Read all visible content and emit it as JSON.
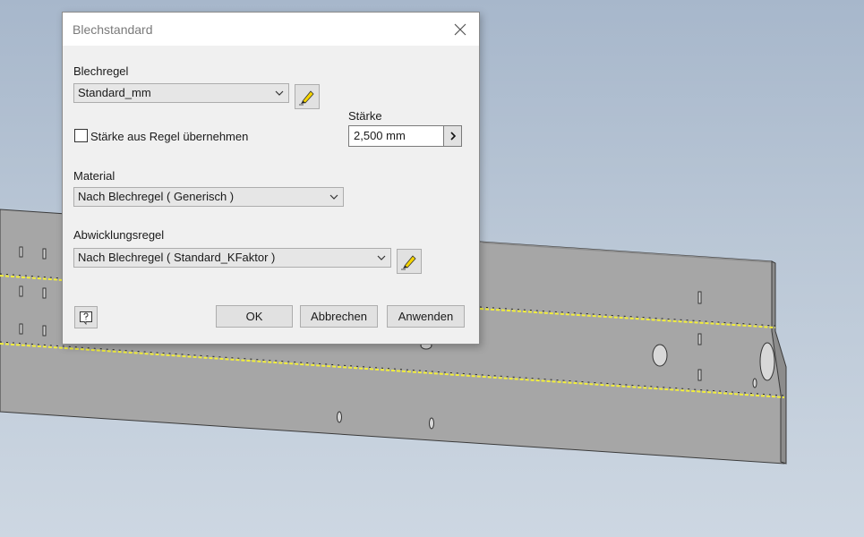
{
  "dialog": {
    "title": "Blechstandard",
    "sheet_rule_label": "Blechregel",
    "sheet_rule_value": "Standard_mm",
    "thickness_label": "Stärke",
    "thickness_value": "2,500 mm",
    "use_rule_thickness_label": "Stärke aus Regel übernehmen",
    "material_label": "Material",
    "material_value": "Nach Blechregel ( Generisch )",
    "unfold_rule_label": "Abwicklungsregel",
    "unfold_rule_value": "Nach Blechregel ( Standard_KFaktor )",
    "ok_label": "OK",
    "cancel_label": "Abbrechen",
    "apply_label": "Anwenden"
  },
  "icons": {
    "close": "close-icon",
    "edit": "pencil-edit-icon",
    "help": "help-icon",
    "chevron": "chevron-down-icon",
    "arrow": "chevron-right-icon"
  },
  "colors": {
    "dialog_bg": "#f0f0f0",
    "sheet_metal": "#a8a8a8",
    "bend_line": "#f5ef3a",
    "viewport_bg_top": "#a7b7cb"
  }
}
